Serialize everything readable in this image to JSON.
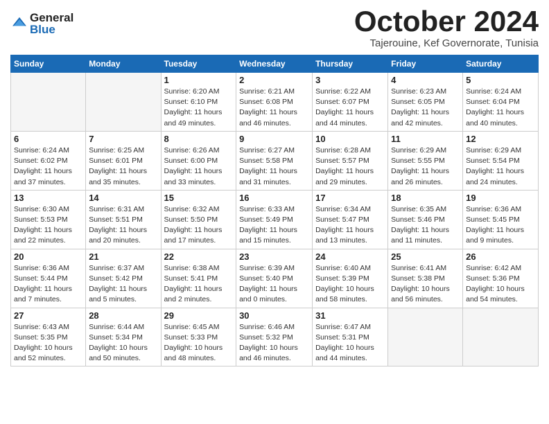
{
  "header": {
    "logo_line1": "General",
    "logo_line2": "Blue",
    "month_title": "October 2024",
    "subtitle": "Tajerouine, Kef Governorate, Tunisia"
  },
  "weekdays": [
    "Sunday",
    "Monday",
    "Tuesday",
    "Wednesday",
    "Thursday",
    "Friday",
    "Saturday"
  ],
  "weeks": [
    [
      {
        "day": "",
        "detail": ""
      },
      {
        "day": "",
        "detail": ""
      },
      {
        "day": "1",
        "detail": "Sunrise: 6:20 AM\nSunset: 6:10 PM\nDaylight: 11 hours and 49 minutes."
      },
      {
        "day": "2",
        "detail": "Sunrise: 6:21 AM\nSunset: 6:08 PM\nDaylight: 11 hours and 46 minutes."
      },
      {
        "day": "3",
        "detail": "Sunrise: 6:22 AM\nSunset: 6:07 PM\nDaylight: 11 hours and 44 minutes."
      },
      {
        "day": "4",
        "detail": "Sunrise: 6:23 AM\nSunset: 6:05 PM\nDaylight: 11 hours and 42 minutes."
      },
      {
        "day": "5",
        "detail": "Sunrise: 6:24 AM\nSunset: 6:04 PM\nDaylight: 11 hours and 40 minutes."
      }
    ],
    [
      {
        "day": "6",
        "detail": "Sunrise: 6:24 AM\nSunset: 6:02 PM\nDaylight: 11 hours and 37 minutes."
      },
      {
        "day": "7",
        "detail": "Sunrise: 6:25 AM\nSunset: 6:01 PM\nDaylight: 11 hours and 35 minutes."
      },
      {
        "day": "8",
        "detail": "Sunrise: 6:26 AM\nSunset: 6:00 PM\nDaylight: 11 hours and 33 minutes."
      },
      {
        "day": "9",
        "detail": "Sunrise: 6:27 AM\nSunset: 5:58 PM\nDaylight: 11 hours and 31 minutes."
      },
      {
        "day": "10",
        "detail": "Sunrise: 6:28 AM\nSunset: 5:57 PM\nDaylight: 11 hours and 29 minutes."
      },
      {
        "day": "11",
        "detail": "Sunrise: 6:29 AM\nSunset: 5:55 PM\nDaylight: 11 hours and 26 minutes."
      },
      {
        "day": "12",
        "detail": "Sunrise: 6:29 AM\nSunset: 5:54 PM\nDaylight: 11 hours and 24 minutes."
      }
    ],
    [
      {
        "day": "13",
        "detail": "Sunrise: 6:30 AM\nSunset: 5:53 PM\nDaylight: 11 hours and 22 minutes."
      },
      {
        "day": "14",
        "detail": "Sunrise: 6:31 AM\nSunset: 5:51 PM\nDaylight: 11 hours and 20 minutes."
      },
      {
        "day": "15",
        "detail": "Sunrise: 6:32 AM\nSunset: 5:50 PM\nDaylight: 11 hours and 17 minutes."
      },
      {
        "day": "16",
        "detail": "Sunrise: 6:33 AM\nSunset: 5:49 PM\nDaylight: 11 hours and 15 minutes."
      },
      {
        "day": "17",
        "detail": "Sunrise: 6:34 AM\nSunset: 5:47 PM\nDaylight: 11 hours and 13 minutes."
      },
      {
        "day": "18",
        "detail": "Sunrise: 6:35 AM\nSunset: 5:46 PM\nDaylight: 11 hours and 11 minutes."
      },
      {
        "day": "19",
        "detail": "Sunrise: 6:36 AM\nSunset: 5:45 PM\nDaylight: 11 hours and 9 minutes."
      }
    ],
    [
      {
        "day": "20",
        "detail": "Sunrise: 6:36 AM\nSunset: 5:44 PM\nDaylight: 11 hours and 7 minutes."
      },
      {
        "day": "21",
        "detail": "Sunrise: 6:37 AM\nSunset: 5:42 PM\nDaylight: 11 hours and 5 minutes."
      },
      {
        "day": "22",
        "detail": "Sunrise: 6:38 AM\nSunset: 5:41 PM\nDaylight: 11 hours and 2 minutes."
      },
      {
        "day": "23",
        "detail": "Sunrise: 6:39 AM\nSunset: 5:40 PM\nDaylight: 11 hours and 0 minutes."
      },
      {
        "day": "24",
        "detail": "Sunrise: 6:40 AM\nSunset: 5:39 PM\nDaylight: 10 hours and 58 minutes."
      },
      {
        "day": "25",
        "detail": "Sunrise: 6:41 AM\nSunset: 5:38 PM\nDaylight: 10 hours and 56 minutes."
      },
      {
        "day": "26",
        "detail": "Sunrise: 6:42 AM\nSunset: 5:36 PM\nDaylight: 10 hours and 54 minutes."
      }
    ],
    [
      {
        "day": "27",
        "detail": "Sunrise: 6:43 AM\nSunset: 5:35 PM\nDaylight: 10 hours and 52 minutes."
      },
      {
        "day": "28",
        "detail": "Sunrise: 6:44 AM\nSunset: 5:34 PM\nDaylight: 10 hours and 50 minutes."
      },
      {
        "day": "29",
        "detail": "Sunrise: 6:45 AM\nSunset: 5:33 PM\nDaylight: 10 hours and 48 minutes."
      },
      {
        "day": "30",
        "detail": "Sunrise: 6:46 AM\nSunset: 5:32 PM\nDaylight: 10 hours and 46 minutes."
      },
      {
        "day": "31",
        "detail": "Sunrise: 6:47 AM\nSunset: 5:31 PM\nDaylight: 10 hours and 44 minutes."
      },
      {
        "day": "",
        "detail": ""
      },
      {
        "day": "",
        "detail": ""
      }
    ]
  ]
}
